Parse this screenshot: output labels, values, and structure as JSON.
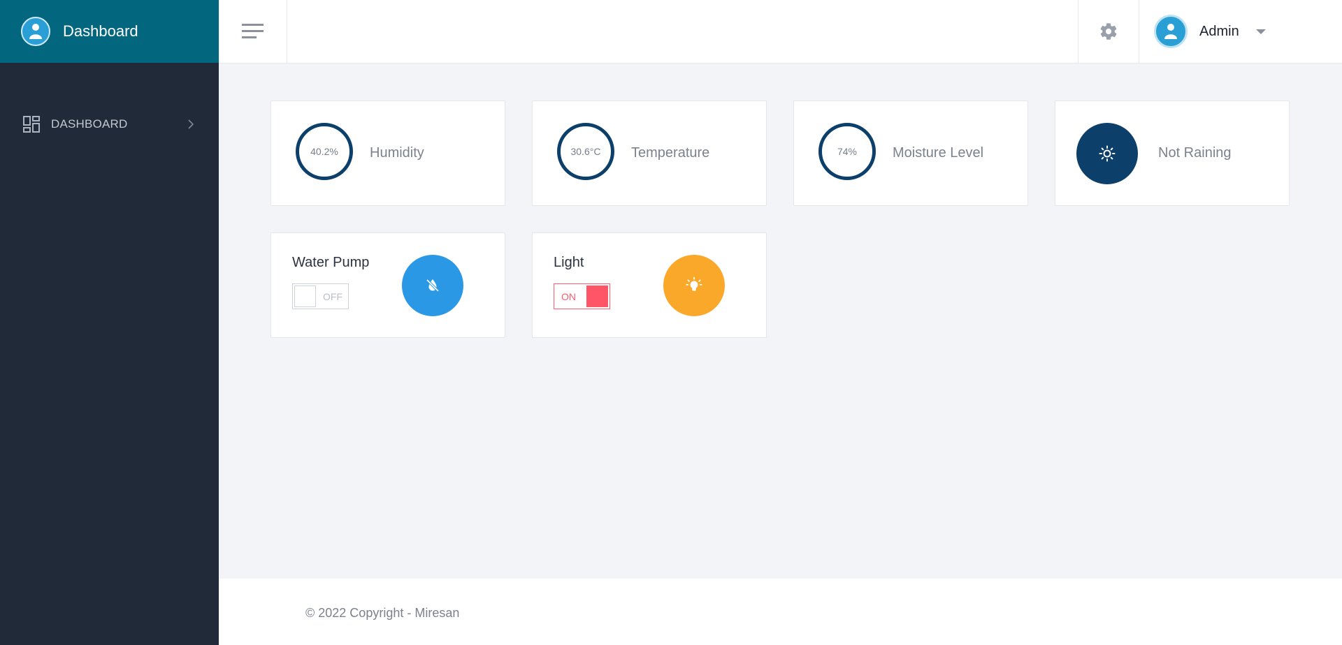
{
  "app": {
    "title": "Dashboard"
  },
  "sidebar": {
    "items": [
      {
        "label": "DASHBOARD",
        "icon": "dashboard-grid-icon"
      }
    ]
  },
  "header": {
    "user": {
      "name": "Admin"
    }
  },
  "sensors": [
    {
      "value": "40.2%",
      "label": "Humidity"
    },
    {
      "value": "30.6°C",
      "label": "Temperature"
    },
    {
      "value": "74%",
      "label": "Moisture Level"
    },
    {
      "label": "Not Raining",
      "icon": "sun-icon"
    }
  ],
  "controls": [
    {
      "title": "Water Pump",
      "state": "OFF",
      "icon": "water-off-icon",
      "color": "#2a98e5"
    },
    {
      "title": "Light",
      "state": "ON",
      "icon": "lightbulb-icon",
      "color": "#faa82a"
    }
  ],
  "footer": {
    "copyright": "© 2022 Copyright - Miresan"
  },
  "colors": {
    "brand": "#02667f",
    "sidebar": "#212a39",
    "ring": "#0c3f6a",
    "rain_circle": "#0c3f6a",
    "toggle_on": "#ff5566"
  }
}
